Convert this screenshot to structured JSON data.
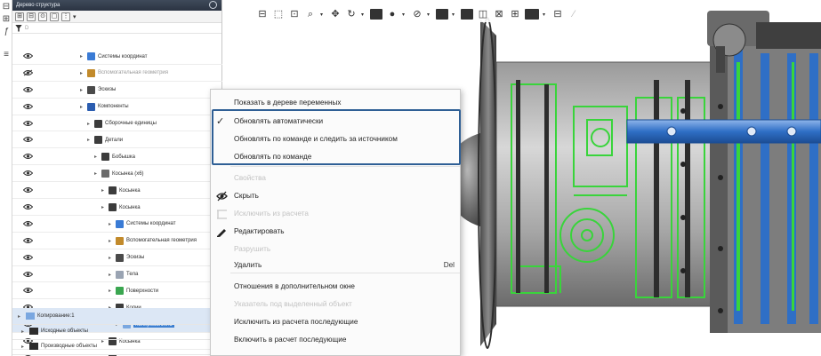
{
  "tree_panel": {
    "title": "Дерево структура",
    "filter_placeholder": "D"
  },
  "tree_rows": [
    {
      "label": "Системы координат",
      "depth": 1,
      "icon": "coordinate-system-icon"
    },
    {
      "label": "Вспомогательная геометрия",
      "depth": 1,
      "icon": "auxiliary-geometry-icon",
      "dim": true
    },
    {
      "label": "Эскизы",
      "depth": 1,
      "icon": "sketch-icon"
    },
    {
      "label": "Компоненты",
      "depth": 1,
      "icon": "components-icon"
    },
    {
      "label": "Сборочные единицы",
      "depth": 2,
      "icon": "assembly-icon"
    },
    {
      "label": "Детали",
      "depth": 2,
      "icon": "parts-icon"
    },
    {
      "label": "Бобышка",
      "depth": 3,
      "icon": "part-icon"
    },
    {
      "label": "Косынка (x6)",
      "depth": 3,
      "icon": "gusset-group-icon"
    },
    {
      "label": "Косынка",
      "depth": 4,
      "icon": "part-icon"
    },
    {
      "label": "Косынка",
      "depth": 4,
      "icon": "part-icon"
    },
    {
      "label": "Системы координат",
      "depth": 5,
      "icon": "coordinate-system-icon"
    },
    {
      "label": "Вспомогательная геометрия",
      "depth": 5,
      "icon": "auxiliary-geometry-icon"
    },
    {
      "label": "Эскизы",
      "depth": 5,
      "icon": "sketch-icon"
    },
    {
      "label": "Тела",
      "depth": 5,
      "icon": "bodies-icon"
    },
    {
      "label": "Поверхности",
      "depth": 5,
      "icon": "surfaces-icon"
    },
    {
      "label": "Копии",
      "depth": 5,
      "icon": "copies-icon"
    },
    {
      "label": "Копирование:1",
      "depth": 6,
      "icon": "copy-operation-icon",
      "selected": true
    },
    {
      "label": "Косынка",
      "depth": 4,
      "icon": "part-icon"
    },
    {
      "label": "Косынка",
      "depth": 4,
      "icon": "part-icon"
    }
  ],
  "tree_bottom": [
    {
      "label": "Копирование:1",
      "icon": "copy-operation-icon"
    },
    {
      "label": "Исходные объекты",
      "icon": "source-objects-icon"
    },
    {
      "label": "Производные объекты",
      "icon": "derived-objects-icon"
    }
  ],
  "context_menu": {
    "items": [
      {
        "label": "Показать в дереве переменных",
        "enabled": true
      },
      {
        "label": "Обновлять автоматически",
        "enabled": true,
        "checked": true
      },
      {
        "label": "Обновлять по команде и следить за источником",
        "enabled": true
      },
      {
        "label": "Обновлять по команде",
        "enabled": true
      },
      {
        "label": "Свойства",
        "enabled": false
      },
      {
        "label": "Скрыть",
        "enabled": true,
        "icon": "hide-icon"
      },
      {
        "label": "Исключить из расчета",
        "enabled": false,
        "icon": "exclude-icon"
      },
      {
        "label": "Редактировать",
        "enabled": true,
        "icon": "edit-icon"
      },
      {
        "label": "Разрушить",
        "enabled": false
      },
      {
        "label": "Удалить",
        "enabled": true,
        "shortcut": "Del"
      },
      {
        "label": "Отношения в дополнительном окне",
        "enabled": true
      },
      {
        "label": "Указатель под выделенный объект",
        "enabled": false
      },
      {
        "label": "Исключить из расчета последующие",
        "enabled": true
      },
      {
        "label": "Включить в расчет последующие",
        "enabled": true
      }
    ]
  },
  "colors": {
    "selection": "#3d7fd0",
    "highlight_frame": "#2f5f95",
    "model_edges": "#39d43b",
    "model_blue": "#2f6fc6"
  }
}
